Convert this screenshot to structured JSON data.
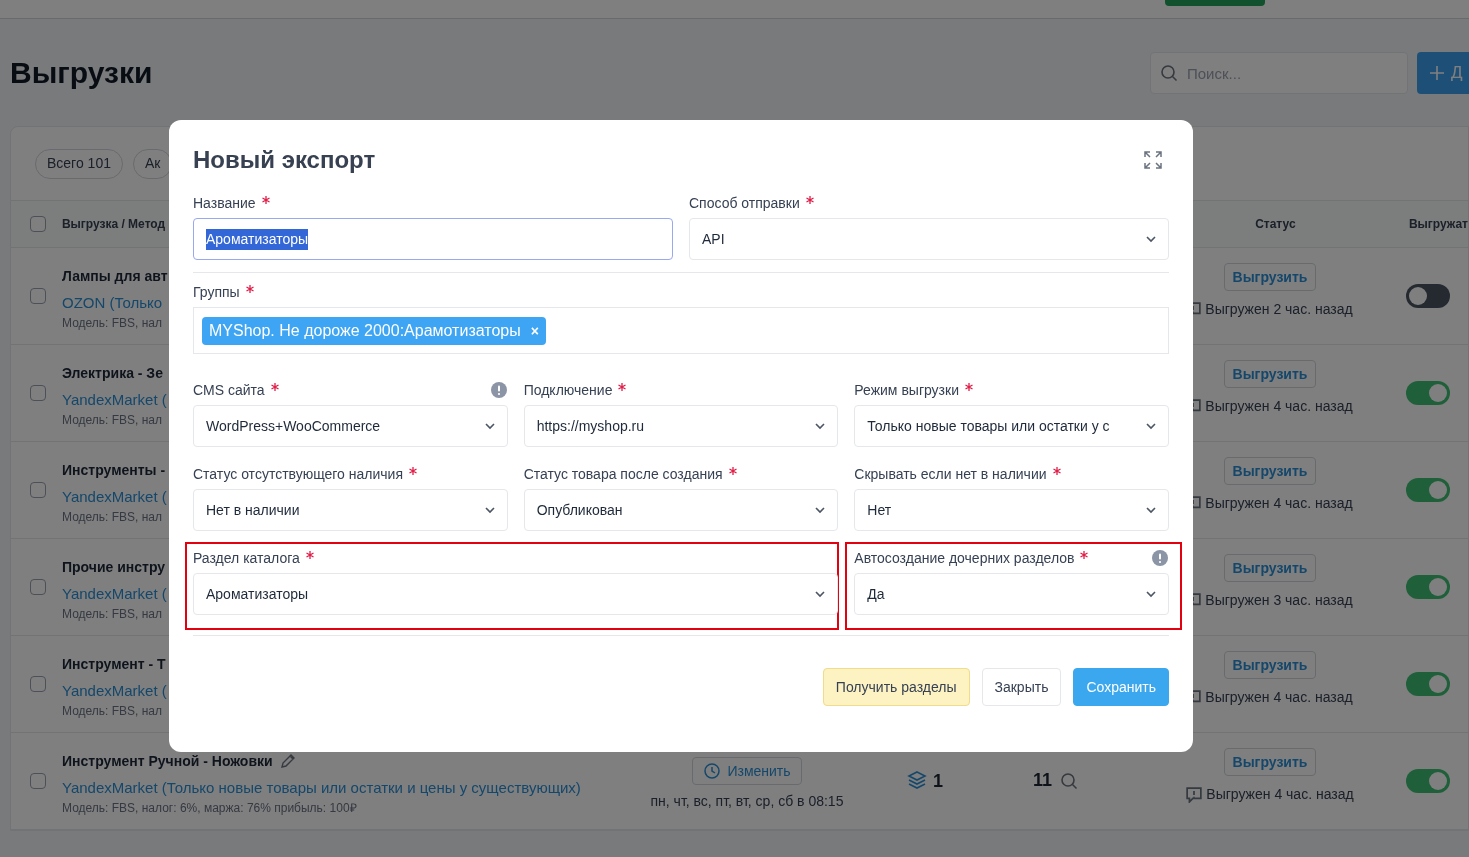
{
  "header": {
    "title": "Выгрузки",
    "search": {
      "placeholder": "Поиск..."
    },
    "add_button": "Д"
  },
  "filters": [
    "Всего 101",
    "Ак"
  ],
  "table": {
    "columns": [
      "Выгрузка / Метод",
      "Статус",
      "Выгружат"
    ],
    "all_checked": false,
    "rows": [
      {
        "title": "Лампы для авт",
        "method": "OZON (Только",
        "checked": false,
        "details": "Модель: FBS, нал",
        "export_button": "Выгрузить",
        "status": "Выгружен 2 час. назад",
        "enabled": false
      },
      {
        "title": "Электрика - Зе",
        "method": "YandexMarket (",
        "checked": false,
        "details": "Модель: FBS, нал",
        "export_button": "Выгрузить",
        "status": "Выгружен 4 час. назад",
        "enabled": true
      },
      {
        "title": "Инструменты -",
        "method": "YandexMarket (",
        "checked": false,
        "details": "Модель: FBS, нал",
        "export_button": "Выгрузить",
        "status": "Выгружен 4 час. назад",
        "enabled": true
      },
      {
        "title": "Прочие инстру",
        "method": "YandexMarket (",
        "checked": false,
        "details": "Модель: FBS, нал",
        "export_button": "Выгрузить",
        "status": "Выгружен 3 час. назад",
        "enabled": true
      },
      {
        "title": "Инструмент - Т",
        "method": "YandexMarket (",
        "checked": false,
        "details": "Модель: FBS, нал",
        "export_button": "Выгрузить",
        "status": "Выгружен 4 час. назад",
        "enabled": true
      },
      {
        "title": "Инструмент Ручной - Ножовки",
        "method": "YandexMarket (Только новые товары или остатки и цены у существующих)",
        "checked": false,
        "details": "Модель: FBS, налог: 6%, маржа: 76% прибыль: 100₽",
        "schedule_button": "Изменить",
        "schedule": "пн, чт, вс, пт, вт, ср, сб в 08:15",
        "groups_count": "1",
        "column_4": "11",
        "export_button": "Выгрузить",
        "status": "Выгружен 4 час. назад",
        "enabled": true
      }
    ]
  },
  "modal": {
    "title": "Новый экспорт",
    "rows": [
      {
        "kind": "halves",
        "fields": [
          {
            "label": "Название",
            "required": true,
            "kind": "input",
            "value": "Ароматизаторы",
            "text_selected": true
          },
          {
            "label": "Способ отправки",
            "required": true,
            "kind": "select",
            "value": "API"
          }
        ]
      },
      {
        "kind": "full",
        "fields": [
          {
            "label": "Группы",
            "required": true,
            "kind": "tags",
            "tags": [
              "MYShop. Не дороже 2000:Арамотизаторы"
            ],
            "remove": "×"
          }
        ]
      },
      {
        "kind": "thirds",
        "fields": [
          {
            "label": "CMS сайта",
            "required": true,
            "kind": "select",
            "value": "WordPress+WooCommerce",
            "info": true
          },
          {
            "label": "Подключение",
            "required": true,
            "kind": "select",
            "value": "https://myshop.ru"
          },
          {
            "label": "Режим выгрузки",
            "required": true,
            "kind": "select",
            "value": "Только новые товары или остатки у с"
          }
        ]
      },
      {
        "kind": "thirds",
        "fields": [
          {
            "label": "Статус отсутствующего наличия",
            "required": true,
            "kind": "select",
            "value": "Нет в наличии"
          },
          {
            "label": "Статус товара после создания",
            "required": true,
            "kind": "select",
            "value": "Опубликован"
          },
          {
            "label": "Скрывать если нет в наличии",
            "required": true,
            "kind": "select",
            "value": "Нет"
          }
        ]
      },
      {
        "kind": "wide_narrow",
        "fields": [
          {
            "label": "Раздел каталога",
            "required": true,
            "kind": "select",
            "value": "Ароматизаторы",
            "highlighted": true
          },
          {
            "label": "Автосоздание дочерних разделов",
            "required": true,
            "kind": "select",
            "value": "Да",
            "info": true,
            "highlighted": true
          }
        ]
      }
    ],
    "buttons": [
      {
        "label": "Получить разделы",
        "kind": "warning"
      },
      {
        "label": "Закрыть",
        "kind": "default"
      },
      {
        "label": "Сохранить",
        "kind": "primary"
      }
    ]
  }
}
